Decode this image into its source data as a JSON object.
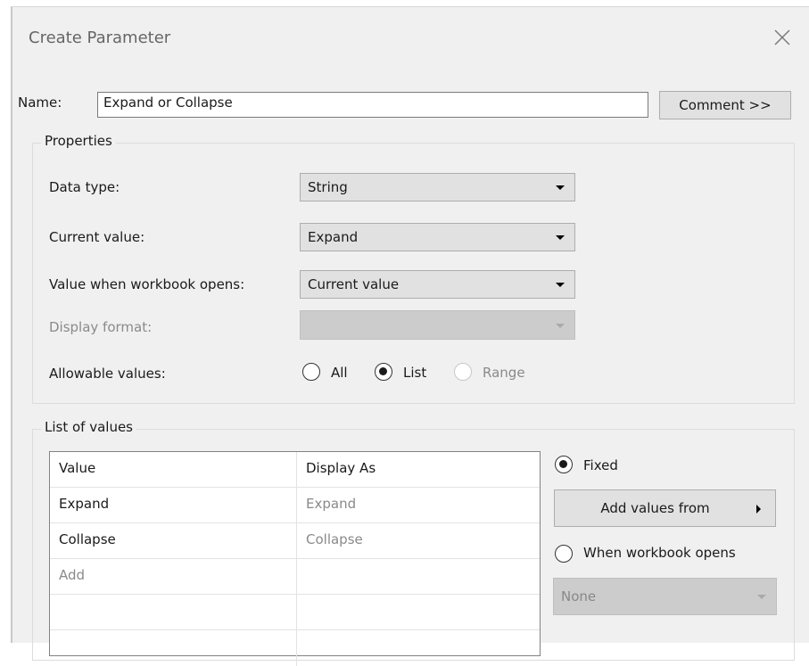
{
  "dialog": {
    "title": "Create Parameter",
    "close_icon": "close-icon"
  },
  "name_row": {
    "label": "Name:",
    "value": "Expand or Collapse",
    "comment_button": "Comment >>"
  },
  "properties": {
    "group_title": "Properties",
    "data_type": {
      "label": "Data type:",
      "value": "String"
    },
    "current_value": {
      "label": "Current value:",
      "value": "Expand"
    },
    "value_on_open": {
      "label": "Value when workbook opens:",
      "value": "Current value"
    },
    "display_format": {
      "label": "Display format:",
      "value": ""
    },
    "allowable_values": {
      "label": "Allowable values:",
      "options": [
        {
          "label": "All",
          "selected": false,
          "enabled": true
        },
        {
          "label": "List",
          "selected": true,
          "enabled": true
        },
        {
          "label": "Range",
          "selected": false,
          "enabled": false
        }
      ]
    }
  },
  "list_of_values": {
    "group_title": "List of values",
    "columns": [
      "Value",
      "Display As"
    ],
    "rows": [
      {
        "value": "Expand",
        "display_as": "Expand"
      },
      {
        "value": "Collapse",
        "display_as": "Collapse"
      },
      {
        "value": "Add",
        "display_as": ""
      }
    ],
    "fixed_label": "Fixed",
    "add_values_button": "Add values from",
    "when_opens_label": "When workbook opens",
    "source_select": "None"
  }
}
